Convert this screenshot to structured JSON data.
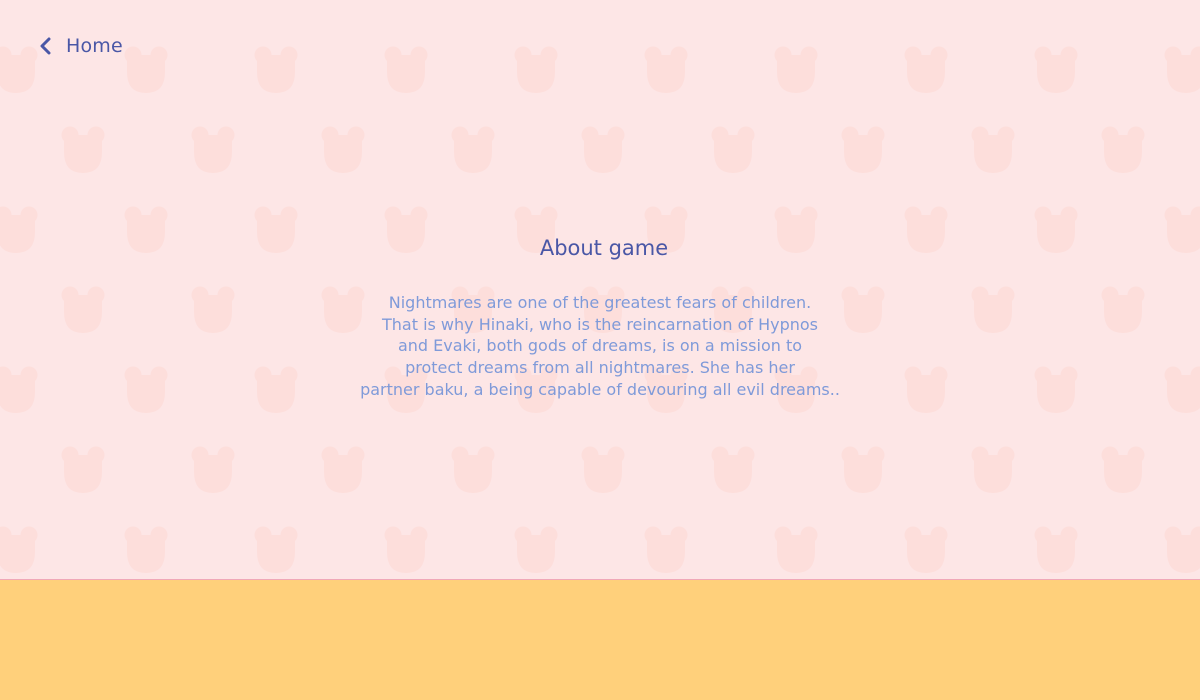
{
  "colors": {
    "background": "#fde6e6",
    "pattern": "#fddedb",
    "divider": "#f0a8b8",
    "footer": "#ffd07b",
    "heading": "#4a57a6",
    "body_text": "#7f9ad9",
    "back_link": "#4a57a6"
  },
  "nav": {
    "back_icon": "chevron-left-icon",
    "back_label": "Home"
  },
  "about": {
    "title": "About game",
    "lines": [
      "Nightmares are one of the greatest fears of children.",
      "That is why Hinaki, who is the reincarnation of Hypnos",
      "and Evaki, both gods of dreams, is on a mission to",
      "protect dreams from all nightmares. She has her",
      "partner baku, a being capable of devouring all evil dreams.."
    ]
  },
  "decor": {
    "pattern_icon": "bear-head-icon"
  }
}
